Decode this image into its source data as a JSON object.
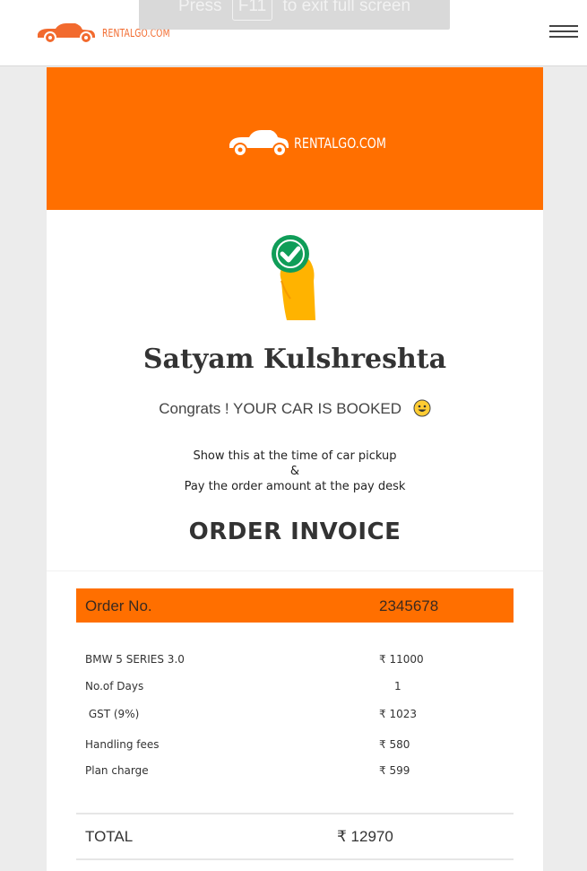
{
  "brand": {
    "name": "RENTALGO.COM",
    "color": "#f26a2e"
  },
  "fullscreen_hint": {
    "prefix": "Press",
    "key": "F11",
    "suffix": "to exit full screen"
  },
  "banner": {
    "logo_text": "RENTALGO.COM",
    "color": "#ff6f00"
  },
  "customer_name": "Satyam Kulshreshta",
  "congrats": "Congrats !  YOUR CAR IS BOOKED",
  "instructions": {
    "line1": "Show this at the time of car pickup",
    "line2": "&",
    "line3": "Pay the order amount at the pay desk"
  },
  "invoice_title": "ORDER INVOICE",
  "order": {
    "label": "Order No.",
    "number": "2345678"
  },
  "items": [
    {
      "label": "BMW 5 SERIES 3.0",
      "value": "₹ 11000"
    },
    {
      "label": "No.of Days",
      "value": "1"
    },
    {
      "label": " GST (9%)",
      "value": "₹ 1023"
    },
    {
      "label": "Handling fees",
      "value": "₹ 580"
    },
    {
      "label": "Plan charge",
      "value": "₹ 599"
    }
  ],
  "total": {
    "label": "TOTAL",
    "value": "₹ 12970"
  },
  "icons": [
    "car-logo-icon",
    "menu-icon",
    "hand-check-icon",
    "smiley-icon"
  ]
}
